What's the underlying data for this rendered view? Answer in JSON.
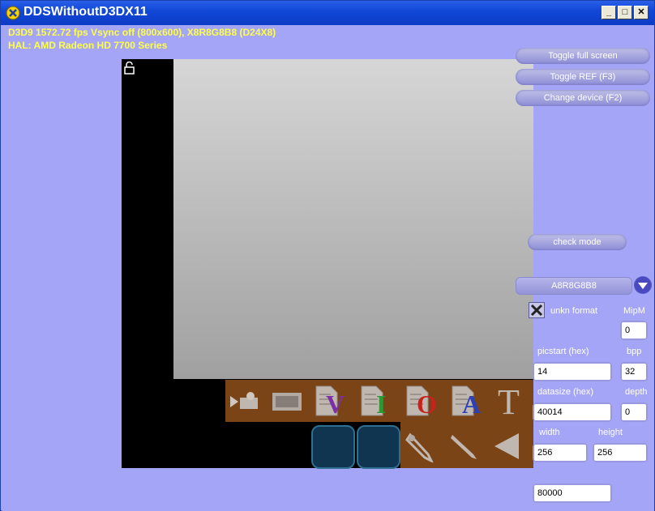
{
  "window": {
    "title": "DDSWithoutD3DX11",
    "min_glyph": "_",
    "max_glyph": "□",
    "close_glyph": "✕"
  },
  "stats": {
    "line1": "D3D9 1572.72 fps Vsync off (800x600), X8R8G8B8 (D24X8)",
    "line2": "HAL: AMD Radeon HD 7700 Series"
  },
  "buttons": {
    "toggle_full_screen": "Toggle full screen",
    "toggle_ref": "Toggle REF (F3)",
    "change_device": "Change device (F2)",
    "check_mode": "check mode"
  },
  "format": {
    "selected": "A8R8G8B8"
  },
  "unknown_format": {
    "label": "unkn format",
    "checked": true
  },
  "fields": {
    "mipm_label": "MipM",
    "mipm_value": "0",
    "picstart_label": "picstart  (hex)",
    "picstart_value": "14",
    "bpp_label": "bpp",
    "bpp_value": "32",
    "datasize_label": "datasize  (hex)",
    "datasize_value": "40014",
    "depth_label": "depth",
    "depth_value": "0",
    "width_label": "width",
    "width_value": "256",
    "height_label": "height",
    "height_value": "256",
    "size_value": "80000"
  },
  "tool_letters": {
    "v": "V",
    "i": "I",
    "o": "O",
    "a": "A",
    "t": "T"
  },
  "icons": [
    "dds-app-icon",
    "lock-icon",
    "camera-icon",
    "film-icon",
    "document-v-icon",
    "document-i-icon",
    "document-o-icon",
    "document-a-icon",
    "text-tool-icon",
    "pen-tool-icon",
    "pencil-icon",
    "arrow-left-icon",
    "dropdown-arrow-icon",
    "checkbox-x-icon"
  ]
}
